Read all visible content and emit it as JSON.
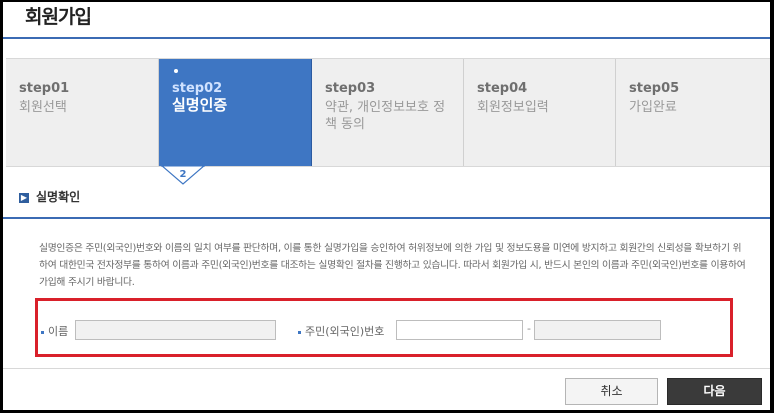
{
  "page_title": "회원가입",
  "steps": [
    {
      "num": "step01",
      "name": "회원선택",
      "active": false
    },
    {
      "num": "step02",
      "name": "실명인증",
      "active": true
    },
    {
      "num": "step03",
      "name": "약관, 개인정보보호 정책 동의",
      "active": false
    },
    {
      "num": "step04",
      "name": "회원정보입력",
      "active": false
    },
    {
      "num": "step05",
      "name": "가입완료",
      "active": false
    }
  ],
  "pointer_number": "2",
  "section": {
    "title": "실명확인"
  },
  "description": "실명인증은 주민(외국인)번호와 이름의 일치 여부를 판단하며, 이를 통한 실명가입을 승인하여 허위정보에 의한 가입 및 정보도용을 미연에 방지하고 회원간의 신뢰성을 확보하기 위하여 대한민국 전자정부를 통하여 이름과 주민(외국인)번호를 대조하는 실명확인 절차를 진행하고 있습니다. 따라서 회원가입 시, 반드시 본인의 이름과 주민(외국인)번호를 이용하여 가입해 주시기 바랍니다.",
  "form": {
    "name_label": "이름",
    "name_value": "",
    "ssn_label": "주민(외국인)번호",
    "ssn_front_value": "",
    "ssn_separator": "-",
    "ssn_back_value": ""
  },
  "buttons": {
    "cancel": "취소",
    "next": "다음"
  },
  "colors": {
    "accent": "#3e76c3",
    "highlight_box": "#d9202a",
    "next_button": "#3a3a3a"
  }
}
